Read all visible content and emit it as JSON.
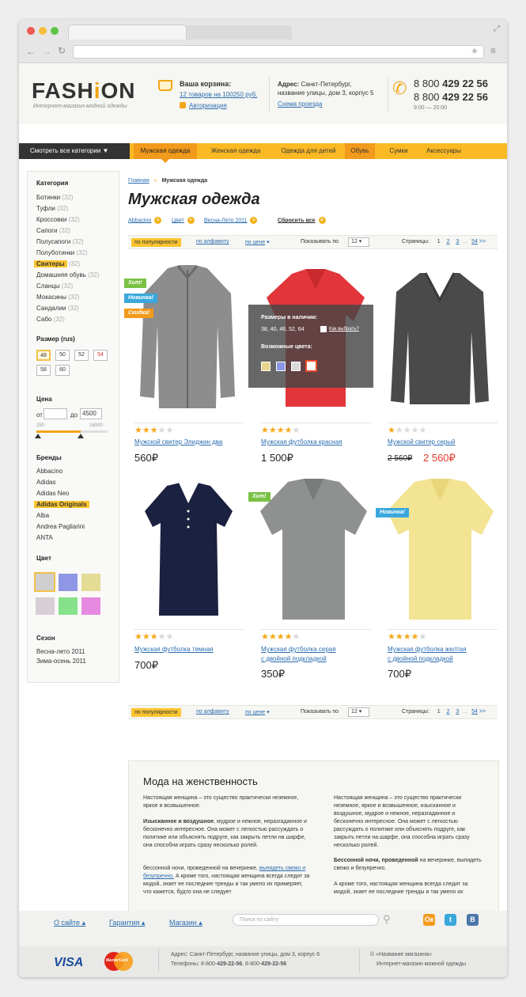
{
  "store": {
    "logo_pre": "FASH",
    "logo_i": "i",
    "logo_post": "ON",
    "slogan": "Интернет-магазин модной одежды"
  },
  "cart": {
    "title": "Ваша корзина:",
    "summary": "12 товаров на 100250 руб.",
    "auth": "Авторизация"
  },
  "address": {
    "label": "Адрес:",
    "line1": "Санкт-Петербург,",
    "line2": "название улицы, дом 3, корпус 5",
    "route": "Схема проезда"
  },
  "phone": {
    "prefix1": "8 800",
    "num1": "429 22 56",
    "prefix2": "8 800",
    "num2": "429 22 56",
    "hours": "9:00 — 20:00"
  },
  "nav": {
    "all": "Смотреть все категории",
    "items": [
      "Мужская одежда",
      "Женская одежда",
      "Одежда для детей",
      "Обувь",
      "Сумки",
      "Аксессуары"
    ]
  },
  "sidebar": {
    "cat_title": "Категория",
    "categories": [
      {
        "name": "Ботинки",
        "count": "(32)"
      },
      {
        "name": "Туфли",
        "count": "(32)"
      },
      {
        "name": "Кроссовки",
        "count": "(32)"
      },
      {
        "name": "Сапоги",
        "count": "(32)"
      },
      {
        "name": "Полусапоги",
        "count": "(32)"
      },
      {
        "name": "Полуботинки",
        "count": "(32)"
      },
      {
        "name": "Свитеры",
        "count": "(32)"
      },
      {
        "name": "Домашняя обувь",
        "count": "(32)"
      },
      {
        "name": "Сланцы",
        "count": "(32)"
      },
      {
        "name": "Мокасины",
        "count": "(32)"
      },
      {
        "name": "Сандалии",
        "count": "(32)"
      },
      {
        "name": "Сабо",
        "count": "(32)"
      }
    ],
    "size_title": "Размер (rus)",
    "sizes": [
      "48",
      "50",
      "52",
      "54",
      "58",
      "60"
    ],
    "price_title": "Цена",
    "price_from_label": "от",
    "price_to_label": "до",
    "price_to": "4500",
    "range_min": "250",
    "range_max": "16000",
    "brand_title": "Бренды",
    "brands": [
      "Abbacino",
      "Adidas",
      "Adidas Neo",
      "Adidas Originals",
      "Alba",
      "Andrea Pagliarini",
      "ANTA"
    ],
    "color_title": "Цвет",
    "colors": [
      "#cfcfcf",
      "#8f96e6",
      "#e4dc94",
      "#d8cfd6",
      "#86e28a",
      "#e58ae0"
    ],
    "season_title": "Сезон",
    "seasons": [
      "Весна-лето 2011",
      "Зима-осень 2011"
    ]
  },
  "breadcrumb": {
    "home": "Главная",
    "sep": "»",
    "current": "Мужская одежда"
  },
  "page_title": "Мужская одежда",
  "filters": {
    "items": [
      "Abbacino",
      "Цвет",
      "Весна-Лето 2011"
    ],
    "reset": "Сбросить все",
    "x": "×"
  },
  "sort": {
    "popular": "по популярности",
    "alpha": "по алфавиту",
    "price": "по цене",
    "show_label": "Показывать по",
    "show_value": "12",
    "pages_label": "Страницы:",
    "pages": [
      "1",
      "2",
      "3",
      "...",
      "54"
    ],
    "next": ">>"
  },
  "badges": {
    "hit": "Хит!",
    "new": "Новинка!",
    "sale": "Скидка!"
  },
  "infobox": {
    "sizes_title": "Размеры в наличии:",
    "sizes": "38, 40, 46, 52, 64",
    "how": "Как выбрать?",
    "colors_title": "Возможные цвета:",
    "colors": [
      "#e6d68a",
      "#8a96e6",
      "#d9d9d9",
      "#e84c2b"
    ]
  },
  "products": [
    {
      "name": [
        "Мужской свитер Элиджин два"
      ],
      "price": "560₽",
      "old_price": "",
      "rating": 3
    },
    {
      "name": [
        "Мужская футболка красная"
      ],
      "price": "1 500₽",
      "old_price": "",
      "rating": 4
    },
    {
      "name": [
        "Мужской свитер серый"
      ],
      "price": "2 560₽",
      "old_price": "2 560₽",
      "rating": 1
    },
    {
      "name": [
        "Мужская футболка темная"
      ],
      "price": "700₽",
      "old_price": "",
      "rating": 3
    },
    {
      "name": [
        "Мужская футболка серая",
        "с двойной подкладкой"
      ],
      "price": "350₽",
      "old_price": "",
      "rating": 4
    },
    {
      "name": [
        "Мужская футболка желтая",
        "с двойной подкладкой"
      ],
      "price": "700₽",
      "old_price": "",
      "rating": 4
    }
  ],
  "seo": {
    "title": "Мода на женственность",
    "left1": "Настоящая женщина – это существо практически неземное, яркое и возвышенное.",
    "left2_bold": "Изысканное и воздушное",
    "left2": ", мудрое и нежное, неразгаданное и бесконечно интересное. Она может с легкостью рассуждать о политике или объяснять подруге, как закрыть петли на шарфе, она способна играть сразу несколько ролей.",
    "left3": "бессонной ночи, проведенной на вечеринке,",
    "left3_link": "выпядеть свежо и безупречно.",
    "left3b": "А кроме того, настоящая женщина всегда следит за модой, знает ее последние тренды и так умело их примеряет, что кажется, будто она не следует",
    "right1": "Настоящая женщина – это существо практически неземное, яркое и возвышенное, изысканное и воздушное, мудрое и нежное, неразгаданное и бесконечно интересное. Она может с легкостью рассуждать о политике или объяснять подруге, как закрыть петли на шарфе, она способна играть сразу несколько ролей.",
    "right2_bold": "Бессонной ночи, проведенной",
    "right2": " на вечеринке, выпядеть свежо и безупречно.",
    "right3": "А кроме того, настоящая женщина всегда следит за модой, знает ее последние тренды и так умело их"
  },
  "footer": {
    "links": [
      "О сайте",
      "Гарантия",
      "Магазин"
    ],
    "search_placeholder": "Поиск по сайту",
    "social": [
      "Ок",
      "t",
      "В"
    ],
    "visa": "VISA",
    "mc": "MasterCard",
    "addr1": "Адрес: Санкт-Петербург, название улицы, дом 3, корпус 6",
    "phones_label": "Телефоны: 8-800-",
    "phone1": "429-22-56",
    "phones_mid": ", 8-800-",
    "phone2": "429-22-56",
    "copy1": "© «Название магазина»",
    "copy2": "Интернет-магазин можной одежды"
  }
}
